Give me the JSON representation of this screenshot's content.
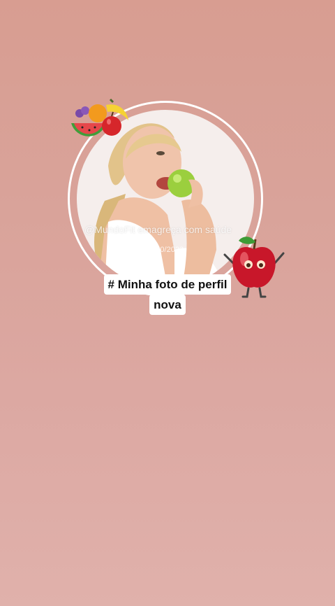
{
  "story": {
    "watermark_handle": "@MundoFit emagreça com saúde",
    "watermark_date": "29/10/2023",
    "caption_line1": "# Minha foto de perfil",
    "caption_line2": "nova"
  },
  "stickers": {
    "fruit_bundle": "fruit-bundle-sticker",
    "apple_character": "apple-character-sticker"
  },
  "colors": {
    "background_top": "#d89d91",
    "background_bottom": "#e0b1ab",
    "ring": "#ffffff",
    "caption_bg": "#ffffff"
  }
}
